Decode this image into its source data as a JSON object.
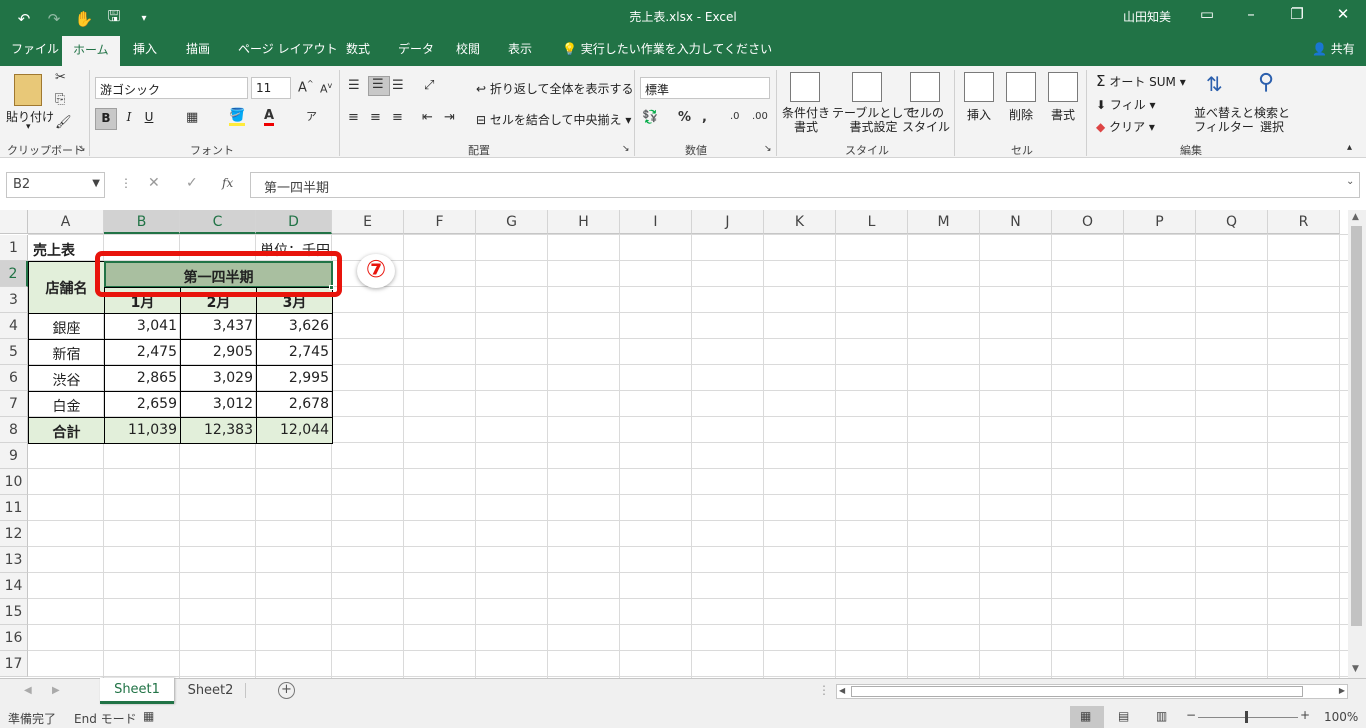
{
  "titlebar": {
    "document_title": "売上表.xlsx  -  Excel",
    "user": "山田知美",
    "bg_color": "#217346"
  },
  "menu": {
    "tabs": [
      "ファイル",
      "ホーム",
      "挿入",
      "描画",
      "ページ レイアウト",
      "数式",
      "データ",
      "校閲",
      "表示"
    ],
    "active": "ホーム",
    "tellme": "実行したい作業を入力してください",
    "share": "共有"
  },
  "ribbon": {
    "clipboard": {
      "paste": "貼り付け",
      "label": "クリップボード"
    },
    "font": {
      "name": "游ゴシック",
      "size": "11",
      "bold": "B",
      "italic": "I",
      "underline": "U",
      "label": "フォント"
    },
    "alignment": {
      "wrap": "折り返して全体を表示する",
      "merge": "セルを結合して中央揃え",
      "label": "配置"
    },
    "number": {
      "format": "標準",
      "label": "数値"
    },
    "styles": {
      "conditional": "条件付き\n書式",
      "table": "テーブルとして\n書式設定",
      "cellstyle": "セルの\nスタイル",
      "label": "スタイル"
    },
    "cells": {
      "insert": "挿入",
      "delete": "削除",
      "format": "書式",
      "label": "セル"
    },
    "editing": {
      "autosum": "オート SUM",
      "fill": "フィル",
      "clear": "クリア",
      "sort": "並べ替えと\nフィルター",
      "find": "検索と\n選択",
      "label": "編集"
    }
  },
  "formula_bar": {
    "name_box": "B2",
    "formula": "第一四半期",
    "fx": "fx"
  },
  "columns": [
    "A",
    "B",
    "C",
    "D",
    "E",
    "F",
    "G",
    "H",
    "I",
    "J",
    "K",
    "L",
    "M",
    "N",
    "O",
    "P",
    "Q",
    "R"
  ],
  "rows": [
    "1",
    "2",
    "3",
    "4",
    "5",
    "6",
    "7",
    "8",
    "9",
    "10",
    "11",
    "12",
    "13",
    "14",
    "15",
    "16",
    "17"
  ],
  "sheet_data": {
    "title": "売上表",
    "unit": "単位：千円",
    "store_header": "店舗名",
    "quarter_header": "第一四半期",
    "months": [
      "1月",
      "2月",
      "3月"
    ],
    "stores": [
      {
        "name": "銀座",
        "values": [
          "3,041",
          "3,437",
          "3,626"
        ]
      },
      {
        "name": "新宿",
        "values": [
          "2,475",
          "2,905",
          "2,745"
        ]
      },
      {
        "name": "渋谷",
        "values": [
          "2,865",
          "3,029",
          "2,995"
        ]
      },
      {
        "name": "白金",
        "values": [
          "2,659",
          "3,012",
          "2,678"
        ]
      }
    ],
    "total": {
      "name": "合計",
      "values": [
        "11,039",
        "12,383",
        "12,044"
      ]
    }
  },
  "callout": {
    "label": "⑦",
    "color": "#e8140c"
  },
  "sheet_tabs": [
    "Sheet1",
    "Sheet2"
  ],
  "active_sheet": "Sheet1",
  "status": {
    "ready": "準備完了",
    "mode": "End モード",
    "zoom": "100%"
  },
  "colors": {
    "header_fill": "#e2efda",
    "selected_fill": "#a9bfa0",
    "accent": "#217346"
  }
}
